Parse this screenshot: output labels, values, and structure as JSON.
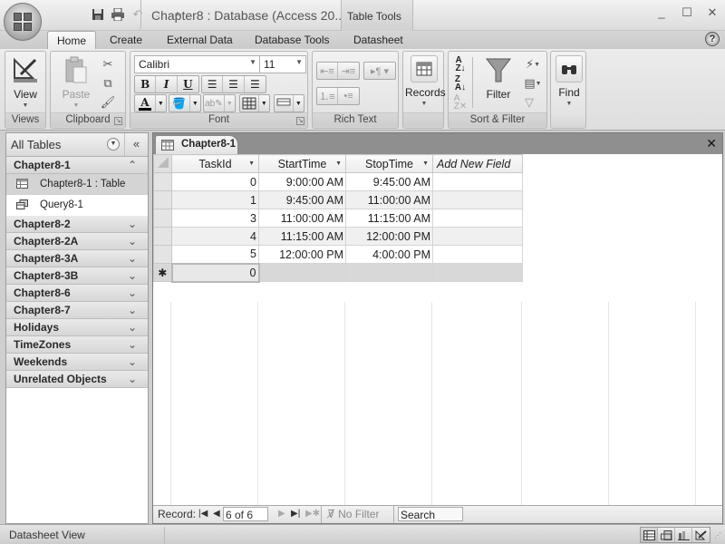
{
  "window": {
    "title": "Chapter8 : Database (Access 20...",
    "context_tab_group": "Table Tools",
    "controls": {
      "minimize": "_",
      "maximize": "☐",
      "close": "✕"
    }
  },
  "quick_access": {
    "save": "save-icon",
    "print": "print-icon",
    "undo": "undo-icon",
    "redo_dropdown": "⌄",
    "customize": "⩡"
  },
  "ribbon_tabs": [
    {
      "label": "Home",
      "active": true
    },
    {
      "label": "Create",
      "active": false
    },
    {
      "label": "External Data",
      "active": false
    },
    {
      "label": "Database Tools",
      "active": false
    },
    {
      "label": "Datasheet",
      "active": false
    }
  ],
  "ribbon": {
    "views": {
      "label": "Views",
      "view_button": "View"
    },
    "clipboard": {
      "label": "Clipboard",
      "paste_button": "Paste"
    },
    "font": {
      "label": "Font",
      "font_name": "Calibri",
      "font_size": "11",
      "bold": "B",
      "italic": "I",
      "underline": "U",
      "font_color_glyph": "A"
    },
    "rich_text": {
      "label": "Rich Text"
    },
    "records": {
      "label": "Records"
    },
    "sort_filter": {
      "label": "Sort & Filter",
      "filter_button": "Filter"
    },
    "find": {
      "label": "Find"
    }
  },
  "nav_pane": {
    "title": "All Tables",
    "groups": [
      {
        "label": "Chapter8-1",
        "expanded": true,
        "items": [
          {
            "label": "Chapter8-1 : Table",
            "type": "table",
            "selected": true
          },
          {
            "label": "Query8-1",
            "type": "query",
            "selected": false
          }
        ]
      },
      {
        "label": "Chapter8-2",
        "expanded": false
      },
      {
        "label": "Chapter8-2A",
        "expanded": false
      },
      {
        "label": "Chapter8-3A",
        "expanded": false
      },
      {
        "label": "Chapter8-3B",
        "expanded": false
      },
      {
        "label": "Chapter8-6",
        "expanded": false
      },
      {
        "label": "Chapter8-7",
        "expanded": false
      },
      {
        "label": "Holidays",
        "expanded": false
      },
      {
        "label": "TimeZones",
        "expanded": false
      },
      {
        "label": "Weekends",
        "expanded": false
      },
      {
        "label": "Unrelated Objects",
        "expanded": false
      }
    ]
  },
  "document": {
    "tab_label": "Chapter8-1",
    "columns": [
      "TaskId",
      "StartTime",
      "StopTime",
      "Add New Field"
    ],
    "rows": [
      {
        "TaskId": "0",
        "StartTime": "9:00:00 AM",
        "StopTime": "9:45:00 AM"
      },
      {
        "TaskId": "1",
        "StartTime": "9:45:00 AM",
        "StopTime": "11:00:00 AM"
      },
      {
        "TaskId": "3",
        "StartTime": "11:00:00 AM",
        "StopTime": "11:15:00 AM"
      },
      {
        "TaskId": "4",
        "StartTime": "11:15:00 AM",
        "StopTime": "12:00:00 PM"
      },
      {
        "TaskId": "5",
        "StartTime": "12:00:00 PM",
        "StopTime": "4:00:00 PM"
      }
    ],
    "new_row": {
      "marker": "✱",
      "TaskId": "0"
    }
  },
  "record_nav": {
    "label": "Record:",
    "current": "6 of 6",
    "filter_status": "No Filter",
    "search_placeholder": "Search"
  },
  "status_bar": {
    "text": "Datasheet View"
  }
}
